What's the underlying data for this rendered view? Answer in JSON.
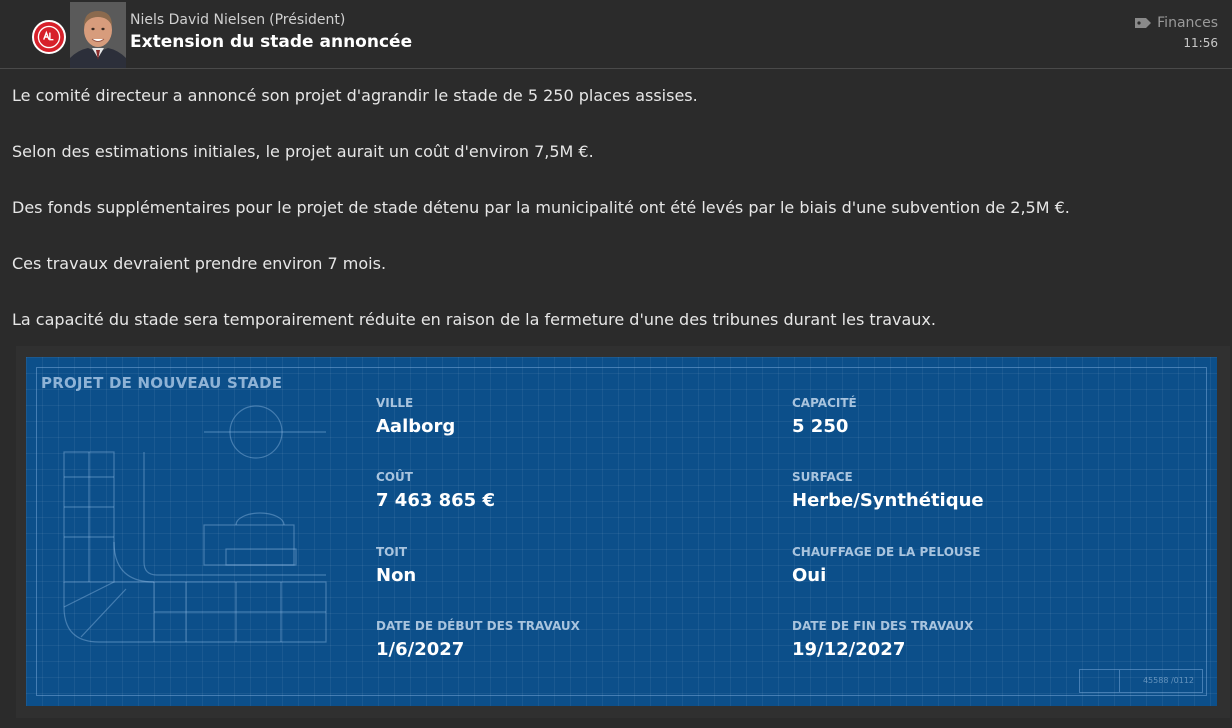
{
  "header": {
    "sender_name": "Niels David Nielsen",
    "sender_role": "(Président)",
    "subject": "Extension du stade annoncée",
    "category": "Finances",
    "category_icon": "tag-icon",
    "time": "11:56",
    "club_badge_color": "#d7202a"
  },
  "body": {
    "paragraphs": [
      "Le comité directeur a annoncé son projet d'agrandir le stade de 5 250 places assises.",
      "Selon des estimations initiales, le projet aurait un coût d'environ 7,5M €.",
      "Des fonds supplémentaires pour le projet de stade détenu par la municipalité ont été levés par le biais d'une subvention de 2,5M €.",
      "Ces travaux devraient prendre environ 7 mois.",
      "La capacité du stade sera temporairement réduite en raison de la fermeture d'une des tribunes durant les travaux."
    ]
  },
  "blueprint": {
    "title": "PROJET DE NOUVEAU STADE",
    "background_color": "#0c4f8a",
    "fields": {
      "city": {
        "label": "VILLE",
        "value": "Aalborg"
      },
      "capacity": {
        "label": "CAPACITÉ",
        "value": "5 250"
      },
      "cost": {
        "label": "COÛT",
        "value": "7 463 865 €"
      },
      "surface": {
        "label": "SURFACE",
        "value": "Herbe/Synthétique"
      },
      "roof": {
        "label": "TOIT",
        "value": "Non"
      },
      "heating": {
        "label": "CHAUFFAGE DE LA PELOUSE",
        "value": "Oui"
      },
      "start_date": {
        "label": "DATE DE DÉBUT DES TRAVAUX",
        "value": "1/6/2027"
      },
      "end_date": {
        "label": "DATE DE FIN DES TRAVAUX",
        "value": "19/12/2027"
      }
    },
    "reference": "45588 /0112"
  }
}
